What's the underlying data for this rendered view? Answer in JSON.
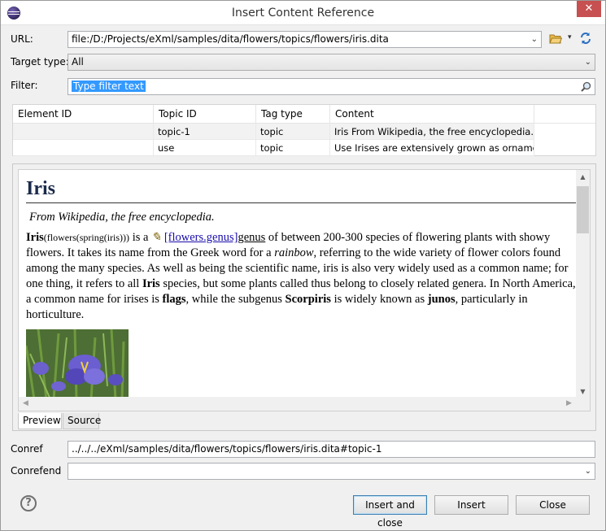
{
  "window": {
    "title": "Insert Content Reference",
    "close_glyph": "✕"
  },
  "url": {
    "label": "URL:",
    "value": "file:/D:/Projects/eXml/samples/dita/flowers/topics/flowers/iris.dita",
    "chevron": "⌄",
    "folder_icon": "folder-open-icon",
    "folder_chevron": "▾",
    "reload_icon": "reload-icon"
  },
  "target_type": {
    "label": "Target type:",
    "value": "All",
    "chevron": "⌄"
  },
  "filter": {
    "label": "Filter:",
    "value": "Type filter text",
    "search_icon": "search-icon"
  },
  "table": {
    "columns": [
      "Element ID",
      "Topic ID",
      "Tag type",
      "Content"
    ],
    "rows": [
      [
        "",
        "topic-1",
        "topic",
        "Iris From Wikipedia, the free encyclopedia. I..."
      ],
      [
        "",
        "use",
        "topic",
        "Use Irises are extensively grown as ornamen..."
      ]
    ]
  },
  "preview": {
    "heading": "Iris",
    "subtitle": "From Wikipedia, the free encyclopedia.",
    "p_bold1": "Iris",
    "p_small": "(flowers(spring(iris)))",
    "p_t1": " is a ",
    "p_pencil": "✎",
    "p_link": "[flowers.genus]",
    "p_link2": "genus",
    "p_t2": " of between 200-300 species of flowering plants with showy flowers. It takes its name from the Greek word for a ",
    "p_italic": "rainbow",
    "p_t3": ", referring to the wide variety of flower colors found among the many species. As well as being the scientific name, iris is also very widely used as a common name; for one thing, it refers to all ",
    "p_bold2": "Iris",
    "p_t4": " species, but some plants called thus belong to closely related genera. In North America, a common name for irises is ",
    "p_bold3": "flags",
    "p_t5": ", while the subgenus ",
    "p_bold4": "Scorpiris",
    "p_t6": " is widely known as ",
    "p_bold5": "junos",
    "p_t7": ", particularly in horticulture.",
    "image_icon": "iris-flower-photo",
    "scroll_up": "▲",
    "scroll_down": "▼",
    "scroll_left": "◀",
    "scroll_right": "▶"
  },
  "tabs": [
    "Preview",
    "Source"
  ],
  "conref": {
    "label": "Conref",
    "value": "../../../eXml/samples/dita/flowers/topics/flowers/iris.dita#topic-1"
  },
  "conrefend": {
    "label": "Conrefend",
    "value": "",
    "chevron": "⌄"
  },
  "buttons": {
    "insert_and_close": "Insert and close",
    "insert": "Insert",
    "close": "Close",
    "help": "?"
  }
}
